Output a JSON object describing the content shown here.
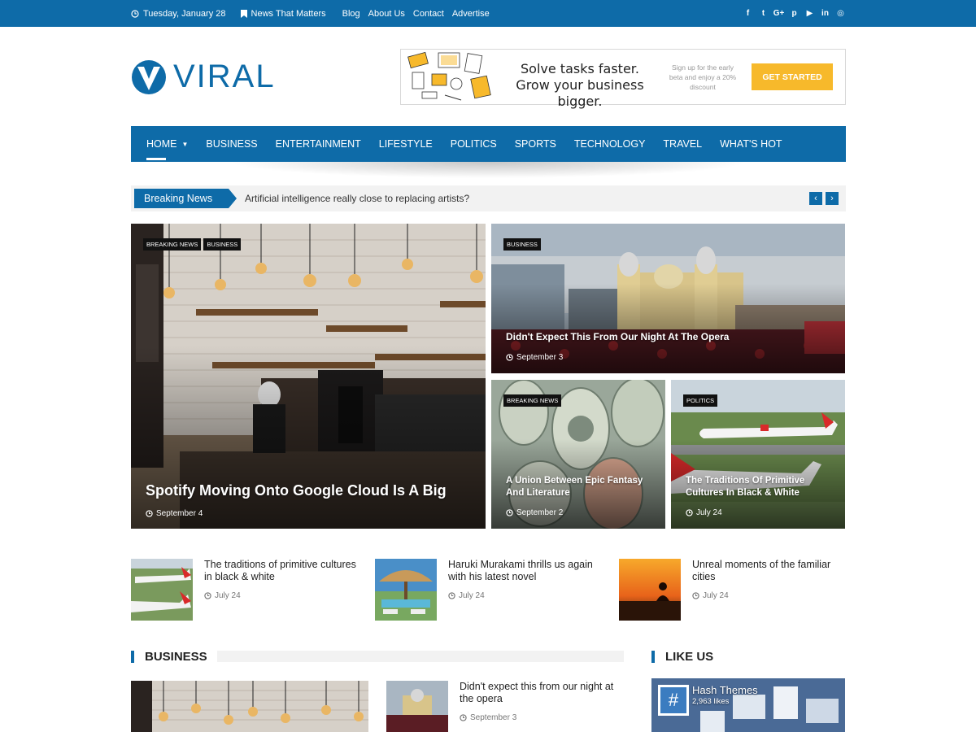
{
  "topbar": {
    "date": "Tuesday, January 28",
    "tagline": "News That Matters",
    "links": [
      "Blog",
      "About Us",
      "Contact",
      "Advertise"
    ],
    "social": [
      {
        "name": "facebook-icon",
        "glyph": "f"
      },
      {
        "name": "twitter-icon",
        "glyph": "t"
      },
      {
        "name": "google-plus-icon",
        "glyph": "G+"
      },
      {
        "name": "pinterest-icon",
        "glyph": "p"
      },
      {
        "name": "youtube-icon",
        "glyph": "▶"
      },
      {
        "name": "linkedin-icon",
        "glyph": "in"
      },
      {
        "name": "instagram-icon",
        "glyph": "◎"
      }
    ]
  },
  "logo": {
    "text": "VIRAL"
  },
  "ad": {
    "headline": "Solve tasks faster. Grow your business bigger.",
    "sub": "Sign up for the early beta and enjoy a 20% discount",
    "button": "GET STARTED"
  },
  "nav": {
    "items": [
      "HOME",
      "BUSINESS",
      "ENTERTAINMENT",
      "LIFESTYLE",
      "POLITICS",
      "SPORTS",
      "TECHNOLOGY",
      "TRAVEL",
      "WHAT'S HOT"
    ]
  },
  "ticker": {
    "label": "Breaking News",
    "text": "Artificial intelligence really close to replacing artists?",
    "prev": "‹",
    "next": "›"
  },
  "featured": {
    "main": {
      "cats": [
        "BREAKING NEWS",
        "BUSINESS"
      ],
      "title": "Spotify Moving Onto Google Cloud Is A Big",
      "date": "September 4"
    },
    "top_right": {
      "cats": [
        "BUSINESS"
      ],
      "title": "Didn't Expect This From Our Night At The Opera",
      "date": "September 3"
    },
    "bottom_left": {
      "cats": [
        "BREAKING NEWS"
      ],
      "title": "A Union Between Epic Fantasy And Literature",
      "date": "September 2"
    },
    "bottom_right": {
      "cats": [
        "POLITICS"
      ],
      "title": "The Traditions Of Primitive Cultures In Black & White",
      "date": "July 24"
    }
  },
  "mini_posts": [
    {
      "title": "The traditions of primitive cultures in black & white",
      "date": "July 24"
    },
    {
      "title": "Haruki Murakami thrills us again with his latest novel",
      "date": "July 24"
    },
    {
      "title": "Unreal moments of the familiar cities",
      "date": "July 24"
    }
  ],
  "business": {
    "title": "BUSINESS",
    "side_post": {
      "title": "Didn't expect this from our night at the opera",
      "date": "September 3"
    }
  },
  "like_us": {
    "title": "LIKE US",
    "page_name": "Hash Themes",
    "likes": "2,963 likes"
  }
}
